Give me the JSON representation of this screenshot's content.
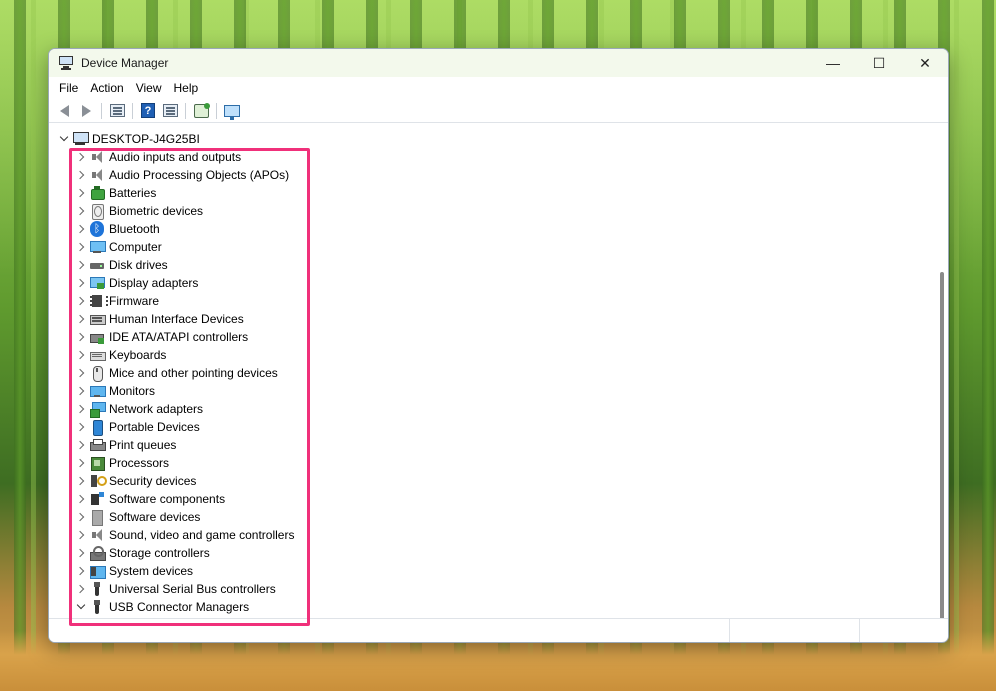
{
  "window": {
    "title": "Device Manager",
    "controls": {
      "minimize": "—",
      "maximize": "☐",
      "close": "✕"
    }
  },
  "menu": [
    "File",
    "Action",
    "View",
    "Help"
  ],
  "toolbar": {
    "icons": [
      "back-icon",
      "forward-icon",
      "properties-icon",
      "help-icon",
      "view-icon",
      "scan-hardware-icon",
      "display-monitor-icon"
    ]
  },
  "tree": {
    "root": "DESKTOP-J4G25BI",
    "items": [
      {
        "label": "Audio inputs and outputs",
        "icon": "speaker-icon",
        "expanded": false
      },
      {
        "label": "Audio Processing Objects (APOs)",
        "icon": "speaker-icon",
        "expanded": false
      },
      {
        "label": "Batteries",
        "icon": "battery-icon",
        "expanded": false
      },
      {
        "label": "Biometric devices",
        "icon": "fingerprint-icon",
        "expanded": false
      },
      {
        "label": "Bluetooth",
        "icon": "bluetooth-icon",
        "expanded": false
      },
      {
        "label": "Computer",
        "icon": "computer-icon",
        "expanded": false
      },
      {
        "label": "Disk drives",
        "icon": "disk-drive-icon",
        "expanded": false
      },
      {
        "label": "Display adapters",
        "icon": "display-adapter-icon",
        "expanded": false
      },
      {
        "label": "Firmware",
        "icon": "chip-icon",
        "expanded": false
      },
      {
        "label": "Human Interface Devices",
        "icon": "hid-icon",
        "expanded": false
      },
      {
        "label": "IDE ATA/ATAPI controllers",
        "icon": "ide-controller-icon",
        "expanded": false
      },
      {
        "label": "Keyboards",
        "icon": "keyboard-icon",
        "expanded": false
      },
      {
        "label": "Mice and other pointing devices",
        "icon": "mouse-icon",
        "expanded": false
      },
      {
        "label": "Monitors",
        "icon": "monitor-icon",
        "expanded": false
      },
      {
        "label": "Network adapters",
        "icon": "network-adapter-icon",
        "expanded": false
      },
      {
        "label": "Portable Devices",
        "icon": "portable-device-icon",
        "expanded": false
      },
      {
        "label": "Print queues",
        "icon": "printer-icon",
        "expanded": false
      },
      {
        "label": "Processors",
        "icon": "processor-icon",
        "expanded": false
      },
      {
        "label": "Security devices",
        "icon": "security-key-icon",
        "expanded": false
      },
      {
        "label": "Software components",
        "icon": "software-component-icon",
        "expanded": false
      },
      {
        "label": "Software devices",
        "icon": "software-device-icon",
        "expanded": false
      },
      {
        "label": "Sound, video and game controllers",
        "icon": "speaker-icon",
        "expanded": false
      },
      {
        "label": "Storage controllers",
        "icon": "storage-controller-icon",
        "expanded": false
      },
      {
        "label": "System devices",
        "icon": "system-device-icon",
        "expanded": false
      },
      {
        "label": "Universal Serial Bus controllers",
        "icon": "usb-icon",
        "expanded": false
      },
      {
        "label": "USB Connector Managers",
        "icon": "usb-icon",
        "expanded": true
      }
    ]
  },
  "colors": {
    "highlight": "#f0307a",
    "titlebar": "#f3f9ec"
  }
}
